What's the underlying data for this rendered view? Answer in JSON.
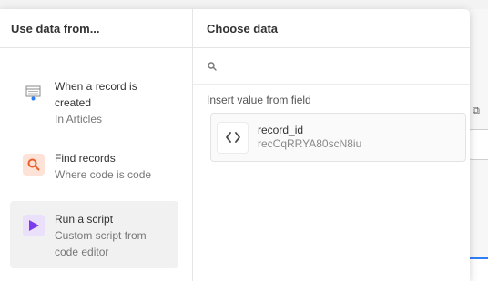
{
  "left_panel": {
    "header": "Use data from...",
    "items": [
      {
        "title": "When a record is created",
        "subtitle": "In Articles",
        "icon": "table-record-icon"
      },
      {
        "title": "Find records",
        "subtitle": "Where code is code",
        "icon": "find-records-icon",
        "icon_color": "#e8612c"
      },
      {
        "title": "Run a script",
        "subtitle": "Custom script from code editor",
        "icon": "play-script-icon",
        "icon_color": "#7c39ed"
      }
    ]
  },
  "right_panel": {
    "header": "Choose data",
    "search": {
      "placeholder": "",
      "value": ""
    },
    "section_label": "Insert value from field",
    "fields": [
      {
        "name": "record_id",
        "value": "recCqRRYA80scN8iu",
        "icon": "code-brackets-icon"
      }
    ]
  },
  "colors": {
    "accent_focus": "#2d7ff9",
    "selected_bg": "#f1f1f1"
  }
}
